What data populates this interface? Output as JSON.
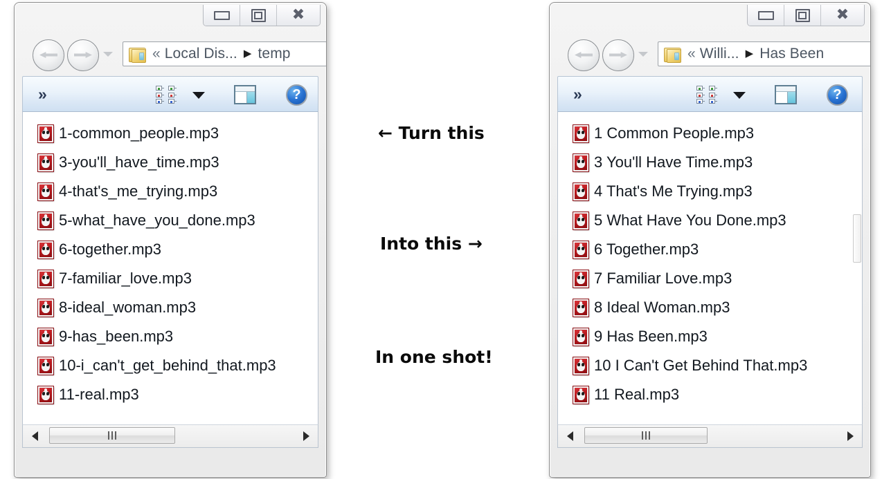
{
  "left_window": {
    "name": "explorer-window-before",
    "titlebar": {
      "minimize_label": "Minimize",
      "maximize_label": "Restore",
      "close_label": "Close",
      "close_glyph": "✖"
    },
    "address": {
      "back_label": "Back",
      "forward_label": "Forward",
      "history_label": "Recent pages",
      "overflow": "«",
      "crumbs": [
        "Local Dis...",
        "temp"
      ],
      "separator": "▶"
    },
    "toolbar": {
      "overflow_label": "»",
      "views_label": "Change your view",
      "caret_label": "More options",
      "preview_label": "Show the preview pane",
      "help_label": "?"
    },
    "files": [
      "1-common_people.mp3",
      "3-you'll_have_time.mp3",
      "4-that's_me_trying.mp3",
      "5-what_have_you_done.mp3",
      "6-together.mp3",
      "7-familiar_love.mp3",
      "8-ideal_woman.mp3",
      "9-has_been.mp3",
      "10-i_can't_get_behind_that.mp3",
      "11-real.mp3"
    ],
    "scrollbar": {
      "left_arrow": "◀",
      "right_arrow": "▶"
    }
  },
  "right_window": {
    "name": "explorer-window-after",
    "titlebar": {
      "minimize_label": "Minimize",
      "maximize_label": "Restore",
      "close_label": "Close",
      "close_glyph": "✖"
    },
    "address": {
      "back_label": "Back",
      "forward_label": "Forward",
      "history_label": "Recent pages",
      "overflow": "«",
      "crumbs": [
        "Willi...",
        "Has Been"
      ],
      "separator": "▶"
    },
    "toolbar": {
      "overflow_label": "»",
      "views_label": "Change your view",
      "caret_label": "More options",
      "preview_label": "Show the preview pane",
      "help_label": "?"
    },
    "files": [
      "1 Common People.mp3",
      "3 You'll Have Time.mp3",
      "4 That's Me Trying.mp3",
      "5 What Have You Done.mp3",
      "6 Together.mp3",
      "7 Familiar Love.mp3",
      "8 Ideal Woman.mp3",
      "9 Has Been.mp3",
      "10 I Can't Get Behind That.mp3",
      "11 Real.mp3"
    ],
    "scrollbar": {
      "left_arrow": "◀",
      "right_arrow": "▶"
    }
  },
  "annotations": {
    "turn_this": "← Turn this",
    "into_this": "Into this →",
    "one_shot": "In one shot!"
  },
  "colors": {
    "file_icon_red": "#b6181d",
    "command_bar_blue": "#dbe8f6",
    "help_blue": "#2a74d4",
    "text": "#12181f"
  }
}
